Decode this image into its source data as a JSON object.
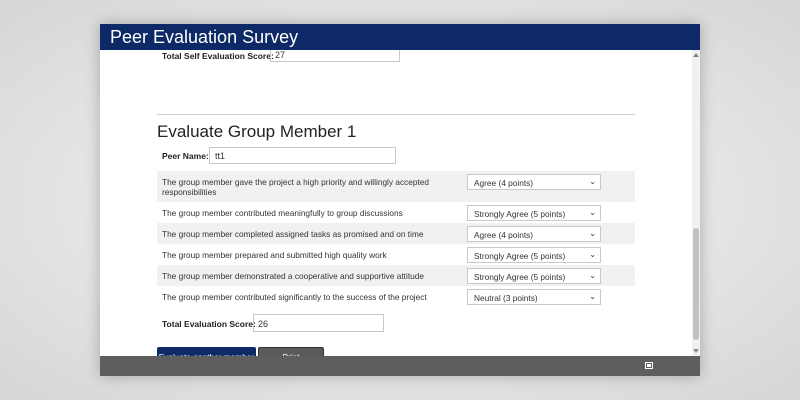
{
  "window": {
    "title": "Peer Evaluation Survey"
  },
  "self_evaluation": {
    "label": "Total Self Evaluation Score:",
    "value": "27"
  },
  "section": {
    "title": "Evaluate Group Member 1"
  },
  "peer_name": {
    "label": "Peer Name:",
    "value": "tt1"
  },
  "questions": [
    {
      "text": "The group member gave the project a high priority and willingly accepted responsibilities",
      "answer": "Agree (4 points)"
    },
    {
      "text": "The group member contributed meaningfully to group discussions",
      "answer": "Strongly Agree (5 points)"
    },
    {
      "text": "The group member completed assigned tasks as promised and on time",
      "answer": "Agree (4 points)"
    },
    {
      "text": "The group member prepared and submitted high quality work",
      "answer": "Strongly Agree (5 points)"
    },
    {
      "text": "The group member demonstrated a cooperative and supportive attitude",
      "answer": "Strongly Agree (5 points)"
    },
    {
      "text": "The group member contributed significantly to the success of the project",
      "answer": "Neutral (3 points)"
    }
  ],
  "total": {
    "label": "Total Evaluation Score:",
    "value": "26"
  },
  "buttons": {
    "evaluate_another": "Evaluate another member",
    "print": "Print"
  },
  "colors": {
    "header": "#0d2a66",
    "footer": "#5e5e5e",
    "print_button": "#5a5a5a"
  },
  "icons": {
    "footer": "window-icon",
    "select": "chevron-down-icon"
  }
}
